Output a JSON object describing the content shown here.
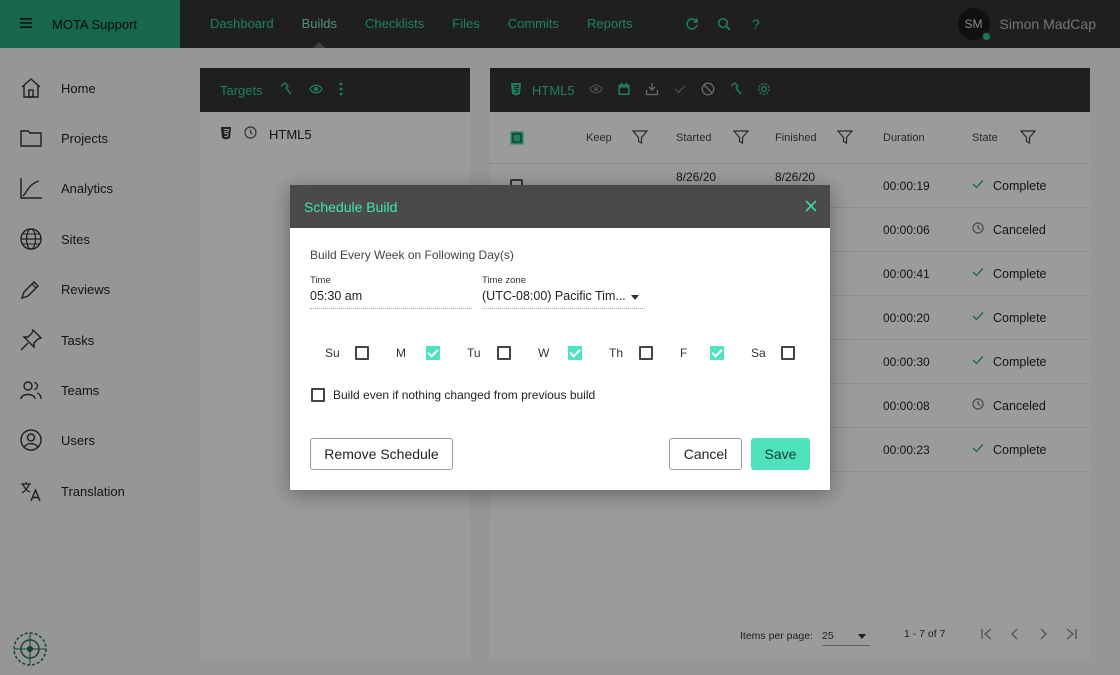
{
  "app": {
    "name": "MOTA Support"
  },
  "nav": {
    "items": [
      "Dashboard",
      "Builds",
      "Checklists",
      "Files",
      "Commits",
      "Reports"
    ],
    "active": "Builds"
  },
  "user": {
    "initials": "SM",
    "name": "Simon MadCap"
  },
  "sidebar": {
    "items": [
      "Home",
      "Projects",
      "Analytics",
      "Sites",
      "Reviews",
      "Tasks",
      "Teams",
      "Users",
      "Translation"
    ]
  },
  "targets": {
    "title": "Targets",
    "items": [
      {
        "label": "HTML5"
      }
    ]
  },
  "builds": {
    "title": "HTML5",
    "columns": {
      "keep": "Keep",
      "started": "Started",
      "finished": "Finished",
      "duration": "Duration",
      "state": "State"
    },
    "rows": [
      {
        "started": "8/26/20",
        "finished": "8/26/20",
        "duration": "00:00:19",
        "state": "Complete"
      },
      {
        "duration": "00:00:06",
        "state": "Canceled"
      },
      {
        "duration": "00:00:41",
        "state": "Complete"
      },
      {
        "duration": "00:00:20",
        "state": "Complete"
      },
      {
        "duration": "00:00:30",
        "state": "Complete"
      },
      {
        "duration": "00:00:08",
        "state": "Canceled"
      },
      {
        "duration": "00:00:23",
        "state": "Complete"
      }
    ],
    "pager": {
      "items_per_page_label": "Items per page:",
      "items_per_page": "25",
      "range": "1 - 7 of 7"
    }
  },
  "dialog": {
    "title": "Schedule Build",
    "subtitle": "Build Every Week on Following Day(s)",
    "time": {
      "label": "Time",
      "value": "05:30 am"
    },
    "timezone": {
      "label": "Time zone",
      "value": "(UTC-08:00) Pacific Tim..."
    },
    "days": [
      {
        "label": "Su",
        "checked": false
      },
      {
        "label": "M",
        "checked": true
      },
      {
        "label": "Tu",
        "checked": false
      },
      {
        "label": "W",
        "checked": true
      },
      {
        "label": "Th",
        "checked": false
      },
      {
        "label": "F",
        "checked": true
      },
      {
        "label": "Sa",
        "checked": false
      }
    ],
    "build_even_label": "Build even if nothing changed from previous build",
    "build_even_checked": false,
    "remove_label": "Remove Schedule",
    "cancel_label": "Cancel",
    "save_label": "Save"
  },
  "colors": {
    "accent": "#2fd09c",
    "brand_bg": "#26a77f",
    "save_bg": "#4fe3bd",
    "dialog_title": "#3ee8b4"
  }
}
